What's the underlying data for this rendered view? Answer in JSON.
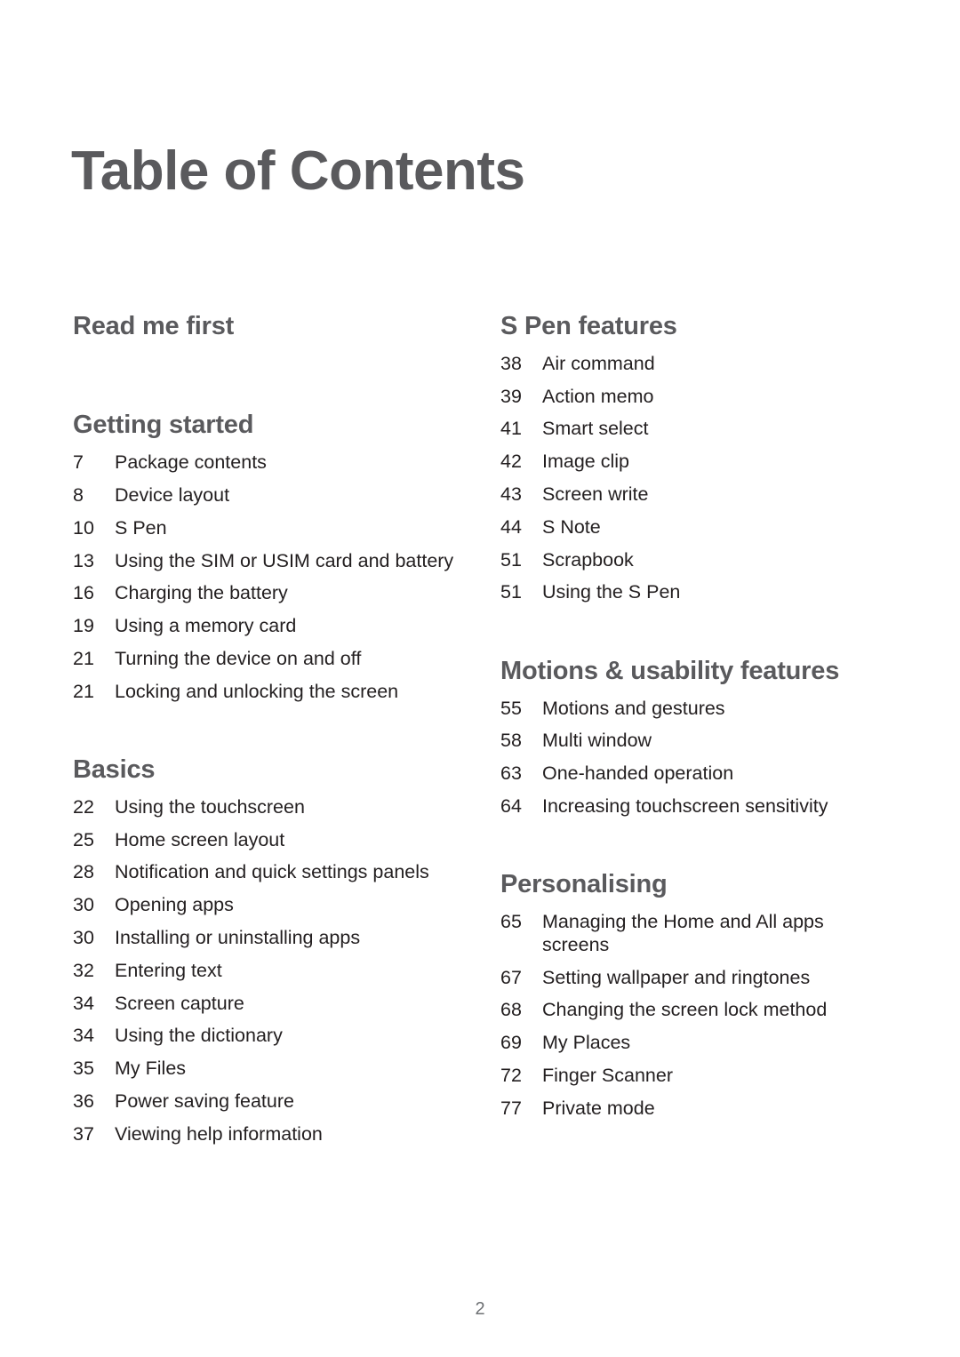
{
  "document": {
    "title": "Table of Contents",
    "page_number": "2"
  },
  "colors": {
    "heading": "#5a5a5d",
    "body": "#231f20",
    "page_number": "#6d7073",
    "background": "#ffffff"
  },
  "columns": {
    "left": [
      {
        "heading": "Read me first",
        "entries": []
      },
      {
        "heading": "Getting started",
        "entries": [
          {
            "page": "7",
            "title": "Package contents"
          },
          {
            "page": "8",
            "title": "Device layout"
          },
          {
            "page": "10",
            "title": "S Pen"
          },
          {
            "page": "13",
            "title": "Using the SIM or USIM card and battery"
          },
          {
            "page": "16",
            "title": "Charging the battery"
          },
          {
            "page": "19",
            "title": "Using a memory card"
          },
          {
            "page": "21",
            "title": "Turning the device on and off"
          },
          {
            "page": "21",
            "title": "Locking and unlocking the screen"
          }
        ]
      },
      {
        "heading": "Basics",
        "entries": [
          {
            "page": "22",
            "title": "Using the touchscreen"
          },
          {
            "page": "25",
            "title": "Home screen layout"
          },
          {
            "page": "28",
            "title": "Notification and quick settings panels"
          },
          {
            "page": "30",
            "title": "Opening apps"
          },
          {
            "page": "30",
            "title": "Installing or uninstalling apps"
          },
          {
            "page": "32",
            "title": "Entering text"
          },
          {
            "page": "34",
            "title": "Screen capture"
          },
          {
            "page": "34",
            "title": "Using the dictionary"
          },
          {
            "page": "35",
            "title": "My Files"
          },
          {
            "page": "36",
            "title": "Power saving feature"
          },
          {
            "page": "37",
            "title": "Viewing help information"
          }
        ]
      }
    ],
    "right": [
      {
        "heading": "S Pen features",
        "entries": [
          {
            "page": "38",
            "title": "Air command"
          },
          {
            "page": "39",
            "title": "Action memo"
          },
          {
            "page": "41",
            "title": "Smart select"
          },
          {
            "page": "42",
            "title": "Image clip"
          },
          {
            "page": "43",
            "title": "Screen write"
          },
          {
            "page": "44",
            "title": "S Note"
          },
          {
            "page": "51",
            "title": "Scrapbook"
          },
          {
            "page": "51",
            "title": "Using the S Pen"
          }
        ]
      },
      {
        "heading": "Motions & usability features",
        "entries": [
          {
            "page": "55",
            "title": "Motions and gestures"
          },
          {
            "page": "58",
            "title": "Multi window"
          },
          {
            "page": "63",
            "title": "One-handed operation"
          },
          {
            "page": "64",
            "title": "Increasing touchscreen sensitivity"
          }
        ]
      },
      {
        "heading": "Personalising",
        "entries": [
          {
            "page": "65",
            "title": "Managing the Home and All apps screens"
          },
          {
            "page": "67",
            "title": "Setting wallpaper and ringtones"
          },
          {
            "page": "68",
            "title": "Changing the screen lock method"
          },
          {
            "page": "69",
            "title": "My Places"
          },
          {
            "page": "72",
            "title": "Finger Scanner"
          },
          {
            "page": "77",
            "title": "Private mode"
          }
        ]
      }
    ]
  }
}
